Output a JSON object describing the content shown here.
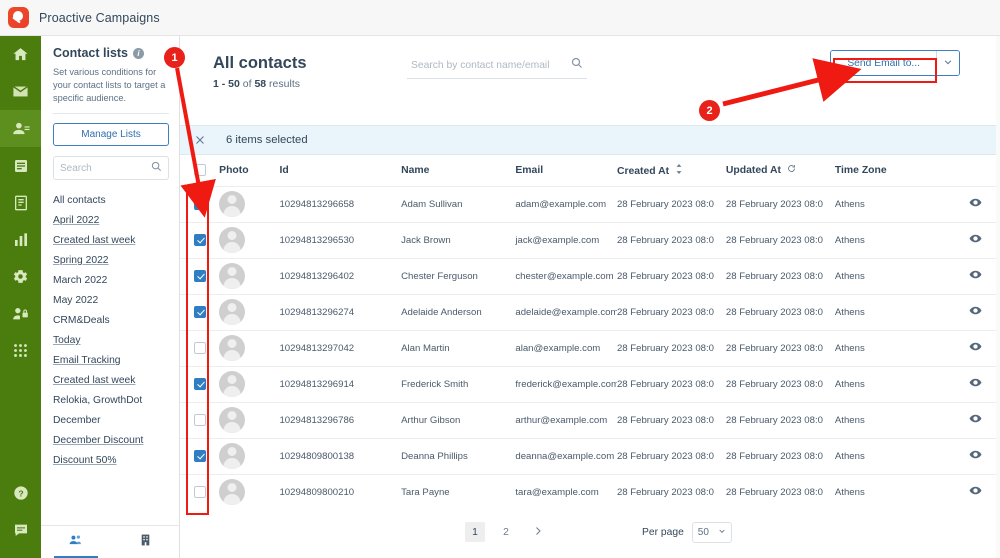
{
  "app": {
    "title": "Proactive Campaigns",
    "logo_icon": "proactive-logo"
  },
  "rail": {
    "items": [
      {
        "name": "home-icon",
        "label": "Home"
      },
      {
        "name": "mail-icon",
        "label": "Email"
      },
      {
        "name": "contacts-icon",
        "label": "Contacts"
      },
      {
        "name": "database-icon",
        "label": "Lists"
      },
      {
        "name": "template-icon",
        "label": "Templates"
      },
      {
        "name": "chart-icon",
        "label": "Reports"
      },
      {
        "name": "gear-icon",
        "label": "Settings"
      },
      {
        "name": "user-lock-icon",
        "label": "Permissions"
      },
      {
        "name": "grid-apps-icon",
        "label": "Apps"
      }
    ],
    "bottom_items": [
      {
        "name": "help-icon",
        "label": "Help"
      },
      {
        "name": "chat-icon",
        "label": "Chat"
      }
    ]
  },
  "panel": {
    "heading": "Contact lists",
    "info_icon": "info-icon",
    "description": "Set various conditions for your contact lists to target a specific audience.",
    "manage_button": "Manage Lists",
    "search_placeholder": "Search",
    "search_value": "",
    "lists": [
      {
        "label": "All contacts",
        "link": false
      },
      {
        "label": "April 2022",
        "link": true
      },
      {
        "label": "Created last week",
        "link": true
      },
      {
        "label": "Spring 2022",
        "link": true
      },
      {
        "label": "March 2022",
        "link": false
      },
      {
        "label": "May 2022",
        "link": false
      },
      {
        "label": "CRM&Deals",
        "link": false
      },
      {
        "label": "Today",
        "link": true
      },
      {
        "label": "Email Tracking",
        "link": true
      },
      {
        "label": "Created last week",
        "link": true
      },
      {
        "label": "Relokia, GrowthDot",
        "link": false
      },
      {
        "label": "December",
        "link": false
      },
      {
        "label": "December Discount",
        "link": true
      },
      {
        "label": "Discount 50%",
        "link": true
      }
    ],
    "tabs": [
      {
        "name": "tab-contacts",
        "icon": "people-icon",
        "active": true
      },
      {
        "name": "tab-companies",
        "icon": "building-icon",
        "active": false
      }
    ]
  },
  "main": {
    "page_title": "All contacts",
    "results_prefix": "1 - 50",
    "results_middle": " of ",
    "results_count": "58",
    "results_suffix": " results",
    "search_placeholder": "Search by contact name/email",
    "search_value": "",
    "send_email_label": "Send Email to...",
    "send_caret_icon": "chevron-down-icon",
    "selection_banner": {
      "close_icon": "close-icon",
      "text": "6 items selected"
    },
    "columns": [
      {
        "key": "checkbox",
        "label": ""
      },
      {
        "key": "photo",
        "label": "Photo"
      },
      {
        "key": "id",
        "label": "Id"
      },
      {
        "key": "name",
        "label": "Name"
      },
      {
        "key": "email",
        "label": "Email"
      },
      {
        "key": "created_at",
        "label": "Created At",
        "sort": "sort-both-icon"
      },
      {
        "key": "updated_at",
        "label": "Updated At",
        "sort": "sort-circle-icon"
      },
      {
        "key": "time_zone",
        "label": "Time Zone"
      },
      {
        "key": "view",
        "label": ""
      }
    ],
    "rows": [
      {
        "checked": true,
        "id": "10294813296658",
        "name": "Adam Sullivan",
        "email": "adam@example.com",
        "created_at": "28 February 2023 08:0",
        "updated_at": "28 February 2023 08:0",
        "time_zone": "Athens"
      },
      {
        "checked": true,
        "id": "10294813296530",
        "name": "Jack Brown",
        "email": "jack@example.com",
        "created_at": "28 February 2023 08:0",
        "updated_at": "28 February 2023 08:0",
        "time_zone": "Athens"
      },
      {
        "checked": true,
        "id": "10294813296402",
        "name": "Chester Ferguson",
        "email": "chester@example.com",
        "created_at": "28 February 2023 08:0",
        "updated_at": "28 February 2023 08:0",
        "time_zone": "Athens"
      },
      {
        "checked": true,
        "id": "10294813296274",
        "name": "Adelaide Anderson",
        "email": "adelaide@example.com",
        "created_at": "28 February 2023 08:0",
        "updated_at": "28 February 2023 08:0",
        "time_zone": "Athens"
      },
      {
        "checked": false,
        "id": "10294813297042",
        "name": "Alan Martin",
        "email": "alan@example.com",
        "created_at": "28 February 2023 08:0",
        "updated_at": "28 February 2023 08:0",
        "time_zone": "Athens"
      },
      {
        "checked": true,
        "id": "10294813296914",
        "name": "Frederick Smith",
        "email": "frederick@example.com",
        "created_at": "28 February 2023 08:0",
        "updated_at": "28 February 2023 08:0",
        "time_zone": "Athens"
      },
      {
        "checked": false,
        "id": "10294813296786",
        "name": "Arthur Gibson",
        "email": "arthur@example.com",
        "created_at": "28 February 2023 08:0",
        "updated_at": "28 February 2023 08:0",
        "time_zone": "Athens"
      },
      {
        "checked": true,
        "id": "10294809800138",
        "name": "Deanna Phillips",
        "email": "deanna@example.com",
        "created_at": "28 February 2023 08:0",
        "updated_at": "28 February 2023 08:0",
        "time_zone": "Athens"
      },
      {
        "checked": false,
        "id": "10294809800210",
        "name": "Tara Payne",
        "email": "tara@example.com",
        "created_at": "28 February 2023 08:0",
        "updated_at": "28 February 2023 08:0",
        "time_zone": "Athens"
      }
    ],
    "pagination": {
      "pages": [
        "1",
        "2"
      ],
      "current": "1",
      "next_icon": "chevron-right-icon",
      "per_page_label": "Per page",
      "per_page_value": "50",
      "per_page_caret": "chevron-down-icon"
    }
  },
  "annotations": [
    {
      "id": "1",
      "label": "1"
    },
    {
      "id": "2",
      "label": "2"
    }
  ],
  "colors": {
    "rail_green": "#4a7c0e",
    "accent_blue": "#2f7ec4",
    "annotation_red": "#e8211a",
    "banner_blue": "#eaf4fb",
    "text_dark": "#33475b"
  }
}
